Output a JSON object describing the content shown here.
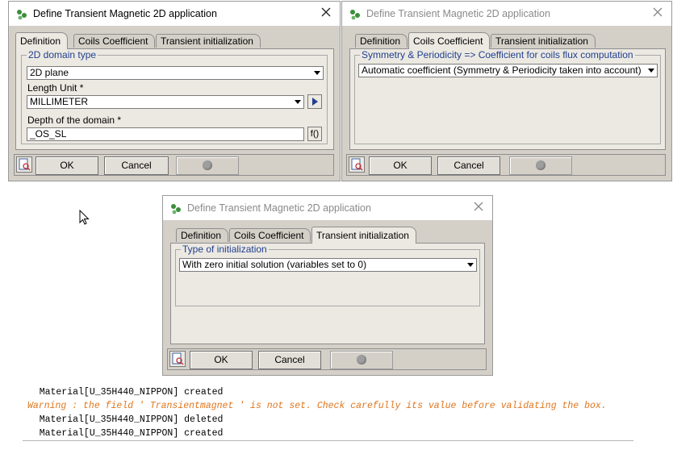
{
  "dialogs": [
    {
      "title": "Define Transient Magnetic 2D application",
      "state": "active",
      "tabs": [
        "Definition",
        "Coils Coefficient",
        "Transient initialization"
      ],
      "active_tab": 0,
      "group_legend": "2D domain type",
      "domain_type_value": "2D plane",
      "length_unit_label": "Length Unit *",
      "length_unit_value": "MILLIMETER",
      "depth_label": "Depth of the domain *",
      "depth_value": "_OS_SL",
      "formula_button": "f()",
      "ok_label": "OK",
      "cancel_label": "Cancel"
    },
    {
      "title": "Define Transient Magnetic 2D application",
      "state": "inactive",
      "tabs": [
        "Definition",
        "Coils Coefficient",
        "Transient initialization"
      ],
      "active_tab": 1,
      "group_legend": "Symmetry & Periodicity => Coefficient for coils flux computation",
      "coefficient_value": "Automatic coefficient (Symmetry & Periodicity taken into account)",
      "ok_label": "OK",
      "cancel_label": "Cancel"
    },
    {
      "title": "Define Transient Magnetic 2D application",
      "state": "inactive",
      "tabs": [
        "Definition",
        "Coils Coefficient",
        "Transient initialization"
      ],
      "active_tab": 2,
      "group_legend": "Type of initialization",
      "init_value": "With zero initial solution (variables set to 0)",
      "ok_label": "OK",
      "cancel_label": "Cancel"
    }
  ],
  "console": {
    "lines": [
      {
        "text": "   Material[U_35H440_NIPPON] created",
        "type": "info"
      },
      {
        "text": "Warning : the field ' Transientmagnet ' is not set. Check carefully its value before validating the box.",
        "type": "warning"
      },
      {
        "text": "   Material[U_35H440_NIPPON] deleted",
        "type": "info"
      },
      {
        "text": "   Material[U_35H440_NIPPON] created",
        "type": "info"
      }
    ]
  },
  "colors": {
    "legend": "#1f3f8f",
    "warning": "#e0761e",
    "dialog_body": "#d4d0c8",
    "panel": "#ece9e2"
  },
  "icons": [
    "flux-app-icon",
    "close-icon",
    "help-icon",
    "chevron-down-icon",
    "play-arrow-icon",
    "disabled-indicator-icon",
    "mouse-cursor-icon"
  ]
}
